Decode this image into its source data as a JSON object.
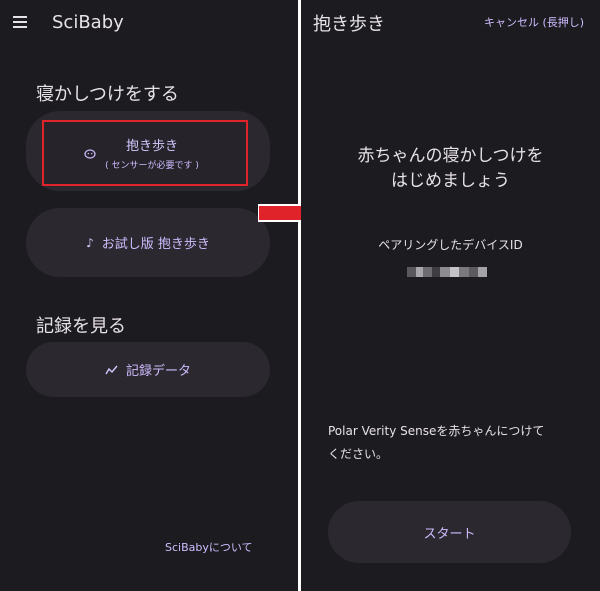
{
  "left": {
    "app_title": "SciBaby",
    "section_sleep": "寝かしつけをする",
    "hold_walk": {
      "title": "抱き歩き",
      "subtitle": "( センサーが必要です )"
    },
    "trial_button": "お試し版 抱き歩き",
    "section_records": "記録を見る",
    "records_button": "記録データ",
    "about_link": "SciBabyについて"
  },
  "right": {
    "title": "抱き歩き",
    "cancel": "キャンセル (長押し)",
    "headline_line1": "赤ちゃんの寝かしつけを",
    "headline_line2": "はじめましょう",
    "paired_label": "ペアリングしたデバイスID",
    "instruction_line1": "Polar Verity Senseを赤ちゃんにつけて",
    "instruction_line2": "ください。",
    "start_button": "スタート"
  },
  "icons": {
    "menu": "hamburger-menu-icon",
    "hold": "baby-face-icon",
    "trial": "music-note-icon",
    "records": "chart-line-icon",
    "transition": "right-arrow-icon"
  },
  "colors": {
    "background": "#1c1b20",
    "surface": "#2b292f",
    "accent": "#cfbcff",
    "highlight": "#e0222b",
    "divider": "#ffffff"
  }
}
